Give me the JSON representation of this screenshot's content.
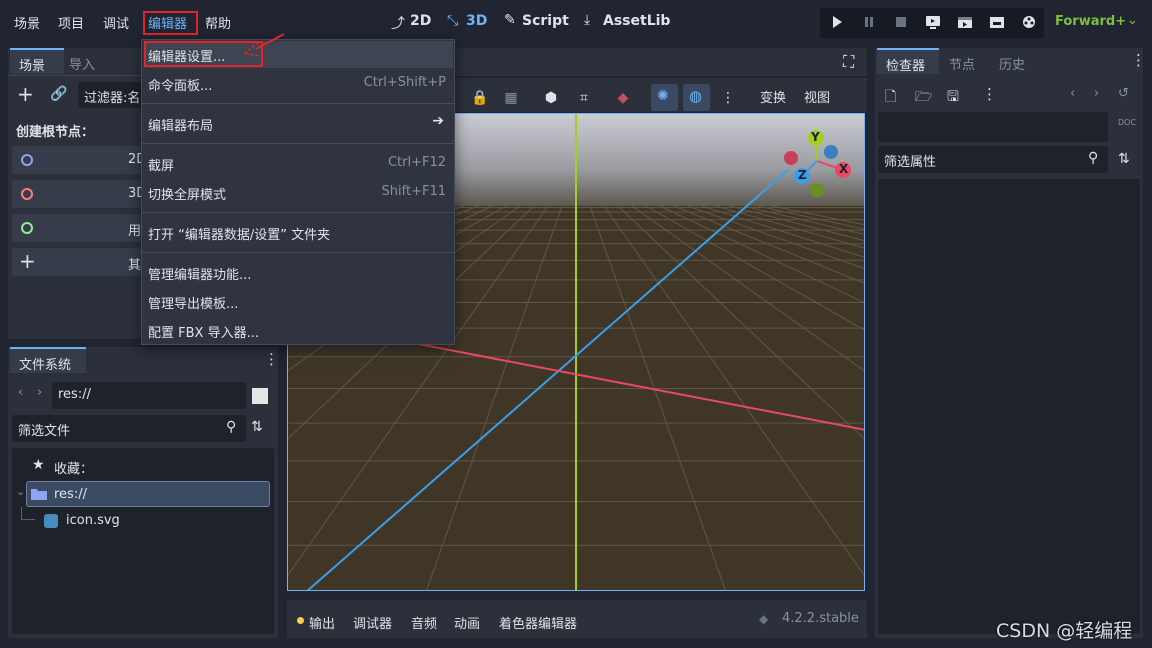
{
  "menubar": {
    "items": [
      "场景",
      "项目",
      "调试",
      "编辑器",
      "帮助"
    ]
  },
  "workspaces": {
    "2d": "2D",
    "3d": "3D",
    "script": "Script",
    "assetlib": "AssetLib"
  },
  "renderer": "Forward+",
  "scene_dock": {
    "tabs": [
      "场景",
      "导入"
    ],
    "filter_placeholder": "过滤器:名",
    "create_root_label": "创建根节点：",
    "root_options": [
      {
        "label": "2D",
        "color": "#8da5f3"
      },
      {
        "label": "3D",
        "color": "#fc7f7f"
      },
      {
        "label": "用",
        "color": "#8eef97"
      },
      {
        "label": "其",
        "color": "#dfe3ea"
      }
    ]
  },
  "editor_menu": {
    "items": [
      {
        "label": "编辑器设置...",
        "shortcut": ""
      },
      {
        "label": "命令面板...",
        "shortcut": "Ctrl+Shift+P"
      },
      {
        "label": "编辑器布局",
        "shortcut": ""
      },
      {
        "label": "截屏",
        "shortcut": "Ctrl+F12"
      },
      {
        "label": "切换全屏模式",
        "shortcut": "Shift+F11"
      },
      {
        "label": "打开 “编辑器数据/设置” 文件夹",
        "shortcut": ""
      },
      {
        "label": "管理编辑器功能...",
        "shortcut": ""
      },
      {
        "label": "管理导出模板...",
        "shortcut": ""
      },
      {
        "label": "配置 FBX 导入器...",
        "shortcut": ""
      }
    ]
  },
  "viewport_toolbar": {
    "transform": "变换",
    "view": "视图"
  },
  "gizmo": {
    "x": "X",
    "y": "Y",
    "z": "Z"
  },
  "filesystem": {
    "tab": "文件系统",
    "path": "res://",
    "filter_placeholder": "筛选文件",
    "favorites": "收藏：",
    "root": "res://",
    "files": [
      "icon.svg"
    ]
  },
  "inspector": {
    "tabs": [
      "检查器",
      "节点",
      "历史"
    ],
    "filter_placeholder": "筛选属性",
    "doc_label": "DOC"
  },
  "bottom_panel": {
    "tabs": [
      "输出",
      "调试器",
      "音频",
      "动画",
      "着色器编辑器"
    ],
    "version": "4.2.2.stable"
  },
  "watermark": "CSDN @轻编程",
  "colors": {
    "accent": "#6fb3f5",
    "highlight_box": "#e0262b",
    "renderer": "#7fbf3f",
    "x_axis": "#e84a5f",
    "y_axis": "#a3cf20",
    "z_axis": "#3c9fe8"
  }
}
